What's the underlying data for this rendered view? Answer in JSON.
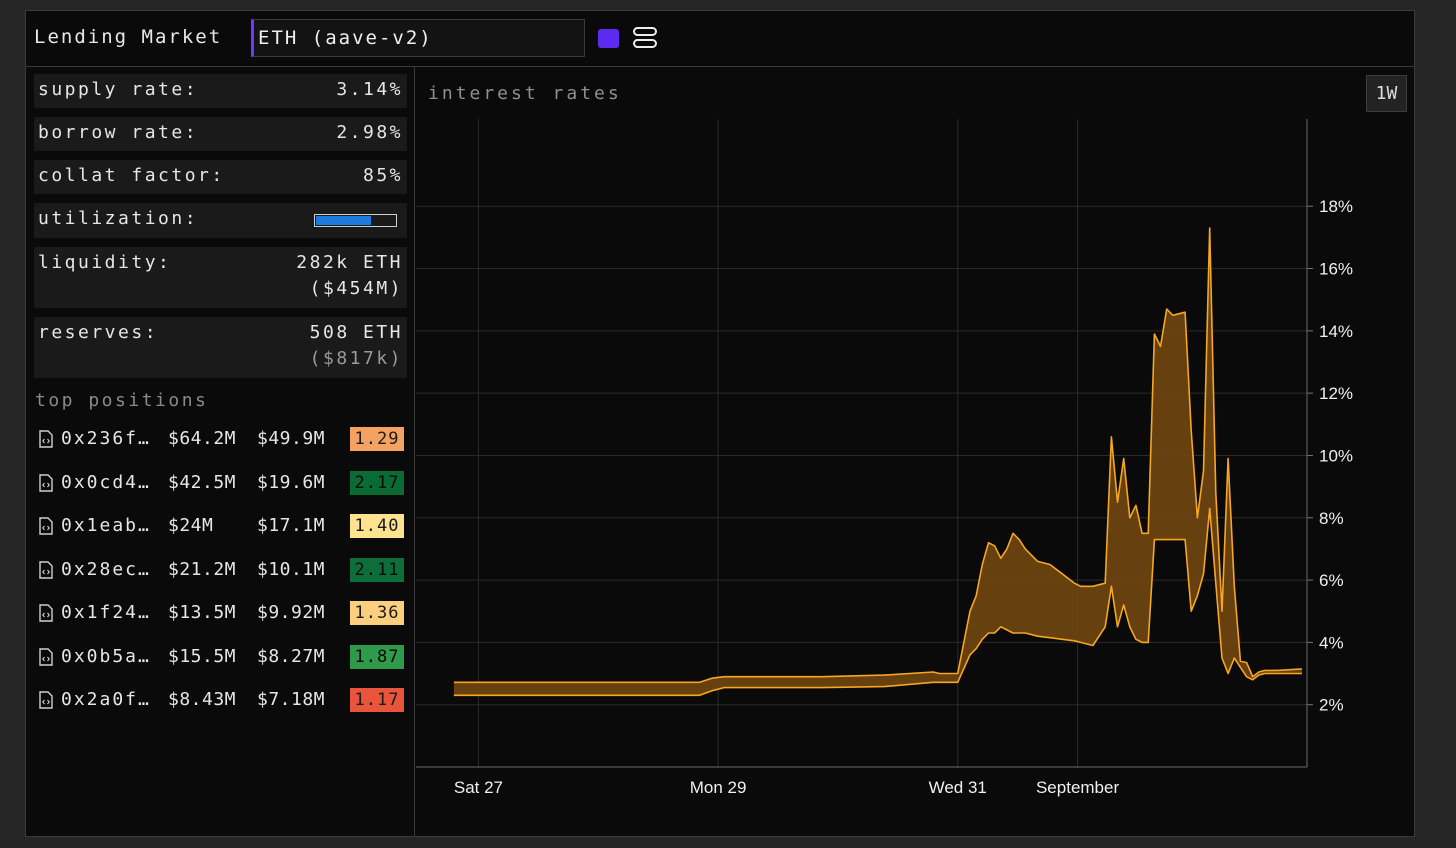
{
  "header": {
    "title": "Lending Market",
    "market_value": "ETH (aave-v2)",
    "swatch_color": "#5b2cf0",
    "layout_icon": "layout-rows-icon"
  },
  "stats": {
    "supply_rate": {
      "label": "supply rate:",
      "value": "3.14%"
    },
    "borrow_rate": {
      "label": "borrow rate:",
      "value": "2.98%"
    },
    "collat_factor": {
      "label": "collat factor:",
      "value": "85%"
    },
    "utilization": {
      "label": "utilization:",
      "fraction": 0.7,
      "bar_color": "#1f7ae0"
    },
    "liquidity": {
      "label": "liquidity:",
      "value": "282k ETH",
      "usd": "($454M)"
    },
    "reserves": {
      "label": "reserves:",
      "value": "508 ETH",
      "usd": "($817k)"
    }
  },
  "positions": {
    "title": "top positions",
    "icon": "contract-file-icon",
    "rows": [
      {
        "address": "0x236f…",
        "collateral": "$64.2M",
        "debt": "$49.9M",
        "health": "1.29",
        "bg": "#f4a261",
        "fg": "#1a1a1a"
      },
      {
        "address": "0x0cd4…",
        "collateral": "$42.5M",
        "debt": "$19.6M",
        "health": "2.17",
        "bg": "#0b6b35",
        "fg": "#0a0a0a"
      },
      {
        "address": "0x1eab…",
        "collateral": "$24M",
        "debt": "$17.1M",
        "health": "1.40",
        "bg": "#fde38f",
        "fg": "#1a1a1a"
      },
      {
        "address": "0x28ec…",
        "collateral": "$21.2M",
        "debt": "$10.1M",
        "health": "2.11",
        "bg": "#0e6e3a",
        "fg": "#0a0a0a"
      },
      {
        "address": "0x1f24…",
        "collateral": "$13.5M",
        "debt": "$9.92M",
        "health": "1.36",
        "bg": "#fbcf7e",
        "fg": "#1a1a1a"
      },
      {
        "address": "0x0b5a…",
        "collateral": "$15.5M",
        "debt": "$8.27M",
        "health": "1.87",
        "bg": "#2f9a4c",
        "fg": "#0a0a0a"
      },
      {
        "address": "0x2a0f…",
        "collateral": "$8.43M",
        "debt": "$7.18M",
        "health": "1.17",
        "bg": "#e8553a",
        "fg": "#1a1a1a"
      }
    ]
  },
  "chart": {
    "title": "interest rates",
    "range_button": "1W"
  },
  "chart_data": {
    "type": "area",
    "title": "interest rates",
    "x_unit": "hours since Fri 26 Aug 00:00",
    "xlim": [
      14,
      159
    ],
    "ylim": [
      0,
      20.8
    ],
    "y_ticks": [
      2,
      4,
      6,
      8,
      10,
      12,
      14,
      16,
      18
    ],
    "y_tick_labels": [
      "2%",
      "4%",
      "6%",
      "8%",
      "10%",
      "12%",
      "14%",
      "16%",
      "18%"
    ],
    "x_ticks": [
      24,
      63,
      102,
      121.5
    ],
    "x_tick_labels": [
      "Sat 27",
      "Mon 29",
      "Wed 31",
      "September"
    ],
    "line_color": "#f5a623",
    "fill_color": "#6b4510",
    "upper_series": {
      "x": [
        20,
        45,
        60,
        62,
        64,
        80,
        90,
        98,
        99,
        102,
        104,
        105,
        106,
        107,
        108,
        109,
        110,
        111,
        112,
        113,
        115,
        117,
        119,
        121,
        122,
        124,
        126,
        127,
        128,
        129,
        130,
        131,
        132,
        133,
        134,
        135,
        136,
        137,
        139,
        140,
        141,
        142,
        143,
        144,
        145,
        146,
        147,
        148,
        149,
        150,
        151,
        152,
        154,
        158
      ],
      "values": [
        2.72,
        2.72,
        2.72,
        2.85,
        2.9,
        2.9,
        2.95,
        3.05,
        3.0,
        3.0,
        5.0,
        5.5,
        6.5,
        7.2,
        7.1,
        6.7,
        7.0,
        7.5,
        7.3,
        7.0,
        6.6,
        6.5,
        6.2,
        5.9,
        5.8,
        5.8,
        5.9,
        10.6,
        8.5,
        9.9,
        8.0,
        8.4,
        7.5,
        7.5,
        13.9,
        13.5,
        14.7,
        14.5,
        14.6,
        10.8,
        8.0,
        9.5,
        17.3,
        8.8,
        5.0,
        9.9,
        5.8,
        3.4,
        3.35,
        2.9,
        3.05,
        3.1,
        3.1,
        3.15
      ]
    },
    "lower_series": {
      "x": [
        20,
        45,
        60,
        62,
        64,
        80,
        90,
        98,
        99,
        102,
        104,
        105,
        106,
        107,
        108,
        109,
        110,
        111,
        112,
        113,
        115,
        117,
        119,
        121,
        122,
        124,
        126,
        127,
        128,
        129,
        130,
        131,
        132,
        133,
        134,
        135,
        136,
        137,
        139,
        140,
        141,
        142,
        143,
        144,
        145,
        146,
        147,
        148,
        149,
        150,
        151,
        152,
        154,
        158
      ],
      "values": [
        2.3,
        2.3,
        2.3,
        2.45,
        2.55,
        2.55,
        2.58,
        2.72,
        2.72,
        2.72,
        3.6,
        3.8,
        4.1,
        4.3,
        4.3,
        4.5,
        4.4,
        4.3,
        4.3,
        4.3,
        4.2,
        4.15,
        4.1,
        4.05,
        4.0,
        3.9,
        4.5,
        5.8,
        4.5,
        5.2,
        4.5,
        4.1,
        4.0,
        4.0,
        7.3,
        7.3,
        7.3,
        7.3,
        7.3,
        5.0,
        5.5,
        6.2,
        8.3,
        5.9,
        3.5,
        3.0,
        3.5,
        3.2,
        2.9,
        2.8,
        2.95,
        3.0,
        3.0,
        3.0
      ]
    }
  }
}
